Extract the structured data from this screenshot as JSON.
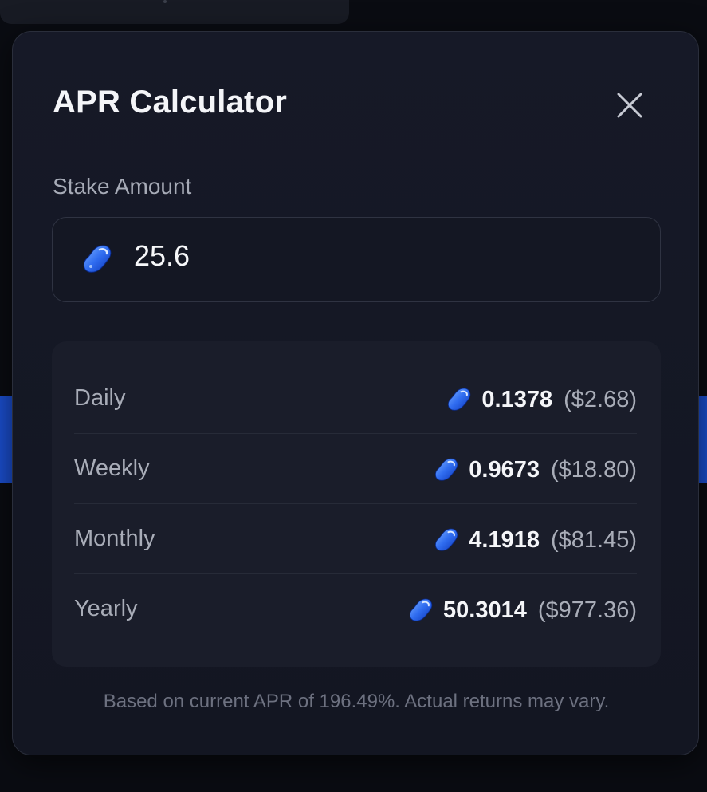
{
  "modal": {
    "title": "APR Calculator",
    "close_icon": "close-icon",
    "stake": {
      "label": "Stake Amount",
      "value": "25.6",
      "token_icon": "jellybean-token-icon"
    },
    "rows": [
      {
        "label": "Daily",
        "amount": "0.1378",
        "usd": "($2.68)"
      },
      {
        "label": "Weekly",
        "amount": "0.9673",
        "usd": "($18.80)"
      },
      {
        "label": "Monthly",
        "amount": "4.1918",
        "usd": "($81.45)"
      },
      {
        "label": "Yearly",
        "amount": "50.3014",
        "usd": "($977.36)"
      }
    ],
    "footnote": "Based on current APR of 196.49%. Actual returns may vary."
  },
  "colors": {
    "accent_blue": "#1b4fd1",
    "token_blue": "#2f6cf0",
    "modal_bg": "#161927"
  }
}
